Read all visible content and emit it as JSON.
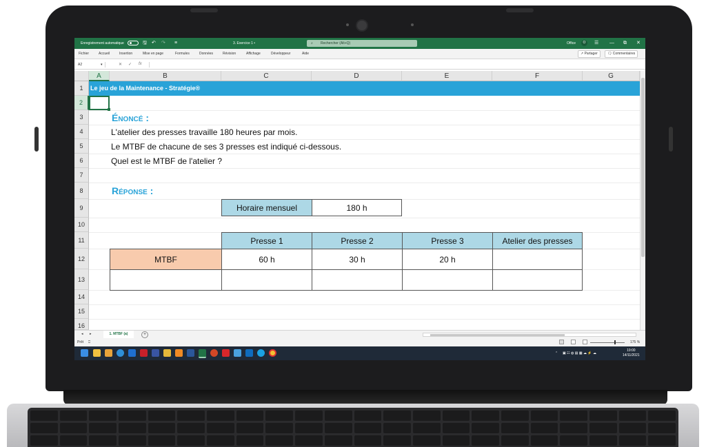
{
  "app": {
    "autosave_label": "Enregistrement automatique",
    "doc_title": "3. Exercice 1 •",
    "search_placeholder": "Rechercher (Alt+Q)",
    "account": "Office",
    "account_badge": "O"
  },
  "window_controls": {
    "minimize": "—",
    "restore": "⧉",
    "close": "✕"
  },
  "menu": [
    "Fichier",
    "Accueil",
    "Insertion",
    "Mise en page",
    "Formules",
    "Données",
    "Révision",
    "Affichage",
    "Développeur",
    "Aide"
  ],
  "actions": {
    "share": "Partager",
    "comments": "Commentaires"
  },
  "formula_bar": {
    "name_box": "A2",
    "fx": "fx",
    "value": ""
  },
  "columns": [
    "A",
    "B",
    "C",
    "D",
    "E",
    "F",
    "G"
  ],
  "rows": [
    "1",
    "2",
    "3",
    "4",
    "5",
    "6",
    "7",
    "8",
    "9",
    "10",
    "11",
    "12",
    "13",
    "14",
    "15",
    "16"
  ],
  "sheet": {
    "title": "Le jeu de la Maintenance - Stratégie®",
    "enonce_heading": "Énoncé :",
    "statement": [
      "L'atelier des presses travaille 180 heures par mois.",
      "Le MTBF de chacune de ses 3 presses est indiqué ci-dessous.",
      "Quel est le MTBF de l'atelier ?"
    ],
    "reponse_heading": "Réponse :",
    "horaire_label": "Horaire mensuel",
    "horaire_value": "180 h",
    "table": {
      "headers": [
        "Presse 1",
        "Presse 2",
        "Presse 3",
        "Atelier des presses"
      ],
      "row_label": "MTBF",
      "values": [
        "60 h",
        "30 h",
        "20 h",
        ""
      ]
    }
  },
  "sheet_tabs": {
    "active": "1. MTBF (a)",
    "add": "+"
  },
  "status": {
    "mode": "Prêt",
    "zoom": "175 %"
  },
  "taskbar": {
    "time": "19:00",
    "date": "14/11/2021"
  },
  "colors": {
    "excel_green": "#217346",
    "title_blue": "#29a3d8",
    "header_fill": "#add8e6",
    "label_fill": "#f8cbad"
  }
}
